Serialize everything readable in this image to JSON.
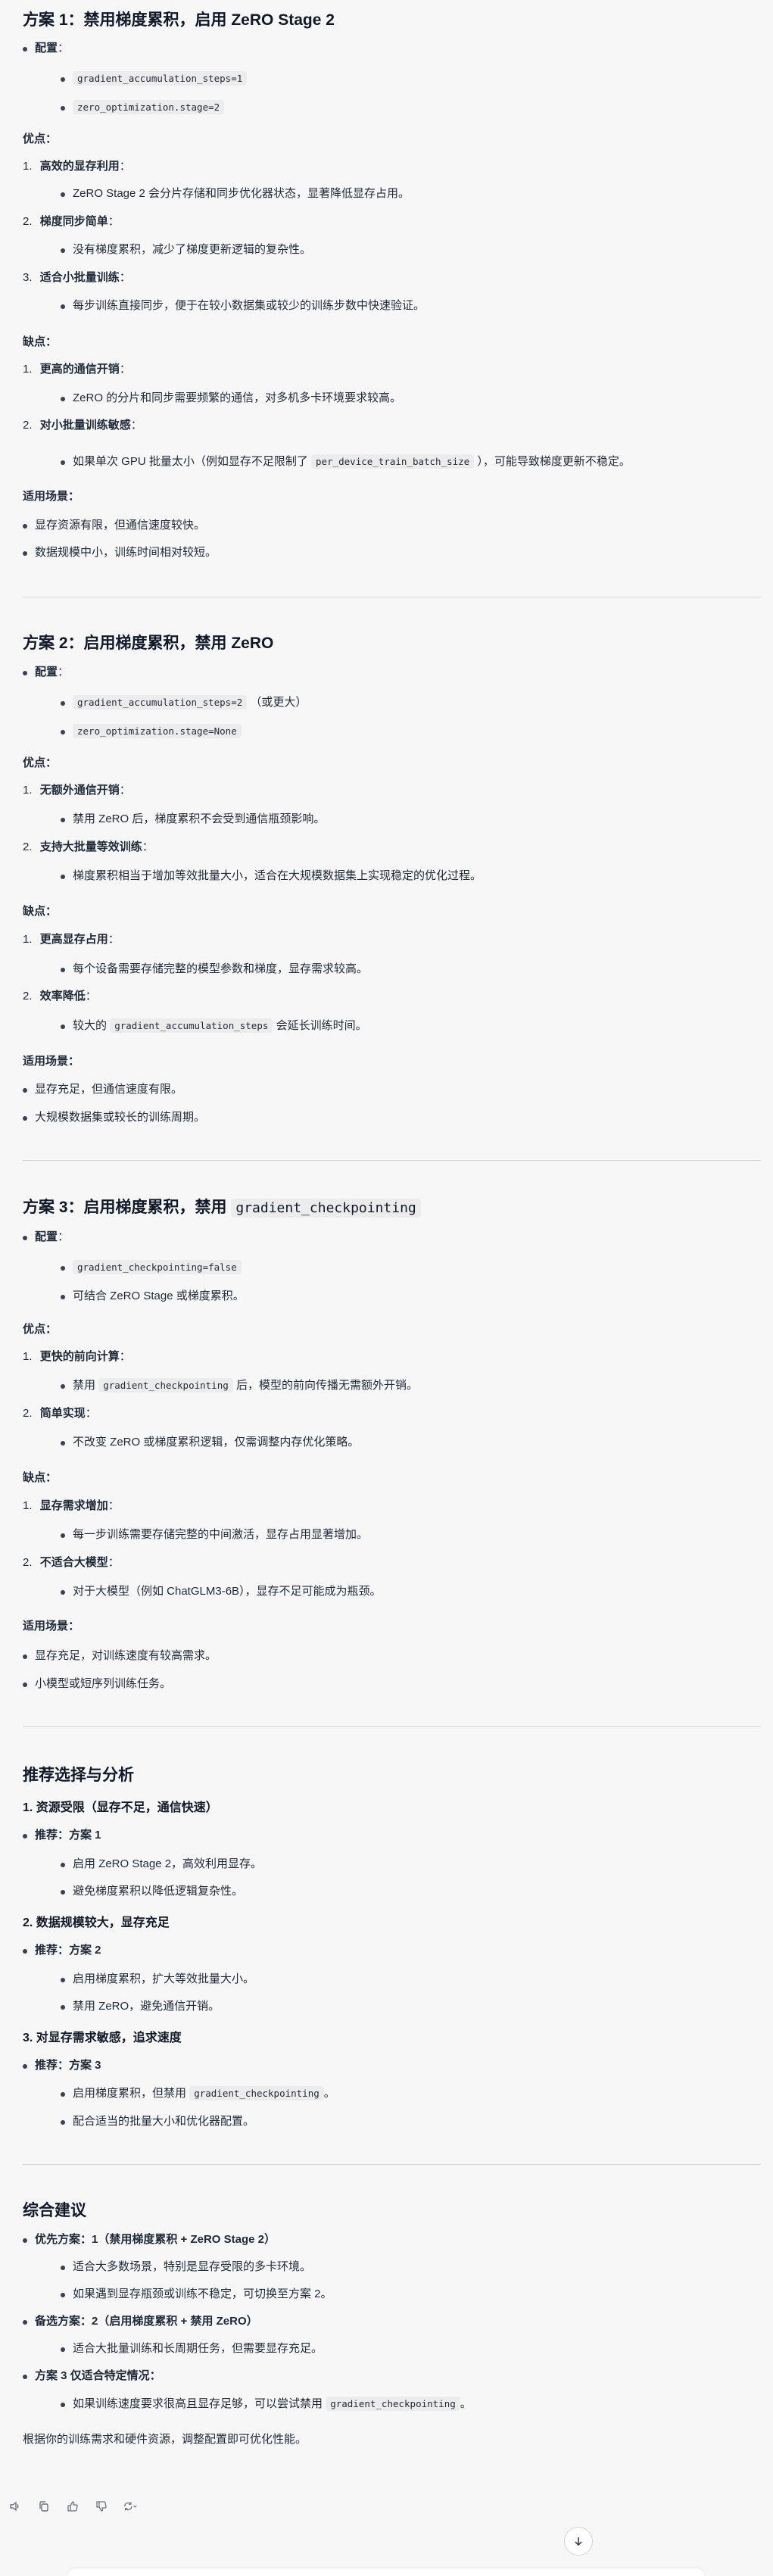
{
  "s1": {
    "title": "方案 1：禁用梯度累积，启用 ZeRO Stage 2",
    "config_label": "配置",
    "config_code1": "gradient_accumulation_steps=1",
    "config_code2": "zero_optimization.stage=2",
    "pros_label": "优点：",
    "pros": [
      {
        "n": "1.",
        "title": "高效的显存利用",
        "desc": "ZeRO Stage 2 会分片存储和同步优化器状态，显著降低显存占用。"
      },
      {
        "n": "2.",
        "title": "梯度同步简单",
        "desc": "没有梯度累积，减少了梯度更新逻辑的复杂性。"
      },
      {
        "n": "3.",
        "title": "适合小批量训练",
        "desc": "每步训练直接同步，便于在较小数据集或较少的训练步数中快速验证。"
      }
    ],
    "cons_label": "缺点：",
    "cons1_n": "1.",
    "cons1_title": "更高的通信开销",
    "cons1_desc": "ZeRO 的分片和同步需要频繁的通信，对多机多卡环境要求较高。",
    "cons2_n": "2.",
    "cons2_title": "对小批量训练敏感",
    "cons2_desc_a": "如果单次 GPU 批量太小（例如显存不足限制了",
    "cons2_code": "per_device_train_batch_size",
    "cons2_desc_b": "），可能导致梯度更新不稳定。",
    "scene_label": "适用场景：",
    "scene1": "显存资源有限，但通信速度较快。",
    "scene2": "数据规模中小，训练时间相对较短。"
  },
  "s2": {
    "title": "方案 2：启用梯度累积，禁用 ZeRO",
    "config_label": "配置",
    "config_code1": "gradient_accumulation_steps=2",
    "config_note1": "（或更大）",
    "config_code2": "zero_optimization.stage=None",
    "pros_label": "优点：",
    "pros1_n": "1.",
    "pros1_title": "无额外通信开销",
    "pros1_desc": "禁用 ZeRO 后，梯度累积不会受到通信瓶颈影响。",
    "pros2_n": "2.",
    "pros2_title": "支持大批量等效训练",
    "pros2_desc": "梯度累积相当于增加等效批量大小，适合在大规模数据集上实现稳定的优化过程。",
    "cons_label": "缺点：",
    "cons1_n": "1.",
    "cons1_title": "更高显存占用",
    "cons1_desc": "每个设备需要存储完整的模型参数和梯度，显存需求较高。",
    "cons2_n": "2.",
    "cons2_title": "效率降低",
    "cons2_desc_a": "较大的",
    "cons2_code": "gradient_accumulation_steps",
    "cons2_desc_b": "会延长训练时间。",
    "scene_label": "适用场景：",
    "scene1": "显存充足，但通信速度有限。",
    "scene2": "大规模数据集或较长的训练周期。"
  },
  "s3": {
    "title_a": "方案 3：启用梯度累积，禁用",
    "title_code": "gradient_checkpointing",
    "config_label": "配置",
    "config_code1": "gradient_checkpointing=false",
    "config_note2": "可结合 ZeRO Stage 或梯度累积。",
    "pros_label": "优点：",
    "pros1_n": "1.",
    "pros1_title": "更快的前向计算",
    "pros1_desc_a": "禁用",
    "pros1_code": "gradient_checkpointing",
    "pros1_desc_b": "后，模型的前向传播无需额外开销。",
    "pros2_n": "2.",
    "pros2_title": "简单实现",
    "pros2_desc": "不改变 ZeRO 或梯度累积逻辑，仅需调整内存优化策略。",
    "cons_label": "缺点：",
    "cons1_n": "1.",
    "cons1_title": "显存需求增加",
    "cons1_desc": "每一步训练需要存储完整的中间激活，显存占用显著增加。",
    "cons2_n": "2.",
    "cons2_title": "不适合大模型",
    "cons2_desc": "对于大模型（例如 ChatGLM3-6B），显存不足可能成为瓶颈。",
    "scene_label": "适用场景：",
    "scene1": "显存充足，对训练速度有较高需求。",
    "scene2": "小模型或短序列训练任务。"
  },
  "rec": {
    "title": "推荐选择与分析",
    "c1_title": "1. 资源受限（显存不足，通信快速）",
    "c1_rec": "推荐：方案 1",
    "c1_i1": "启用 ZeRO Stage 2，高效利用显存。",
    "c1_i2": "避免梯度累积以降低逻辑复杂性。",
    "c2_title": "2. 数据规模较大，显存充足",
    "c2_rec": "推荐：方案 2",
    "c2_i1": "启用梯度累积，扩大等效批量大小。",
    "c2_i2": "禁用 ZeRO，避免通信开销。",
    "c3_title": "3. 对显存需求敏感，追求速度",
    "c3_rec": "推荐：方案 3",
    "c3_i1_a": "启用梯度累积，但禁用",
    "c3_i1_code": "gradient_checkpointing",
    "c3_i1_b": "。",
    "c3_i2": "配合适当的批量大小和优化器配置。"
  },
  "summary": {
    "title": "综合建议",
    "p1": "优先方案：1（禁用梯度累积 + ZeRO Stage 2）",
    "p1_i1": "适合大多数场景，特别是显存受限的多卡环境。",
    "p1_i2": "如果遇到显存瓶颈或训练不稳定，可切换至方案 2。",
    "p2": "备选方案：2（启用梯度累积 + 禁用 ZeRO）",
    "p2_i1": "适合大批量训练和长周期任务，但需要显存充足。",
    "p3": "方案 3 仅适合特定情况：",
    "p3_i1_a": "如果训练速度要求很高且显存足够，可以尝试禁用",
    "p3_i1_code": "gradient_checkpointing",
    "p3_i1_b": "。",
    "closing": "根据你的训练需求和硬件资源，调整配置即可优化性能。"
  },
  "toolbar": {
    "icons": [
      "speaker-icon",
      "copy-icon",
      "thumbs-up-icon",
      "thumbs-down-icon",
      "regenerate-icon"
    ]
  }
}
